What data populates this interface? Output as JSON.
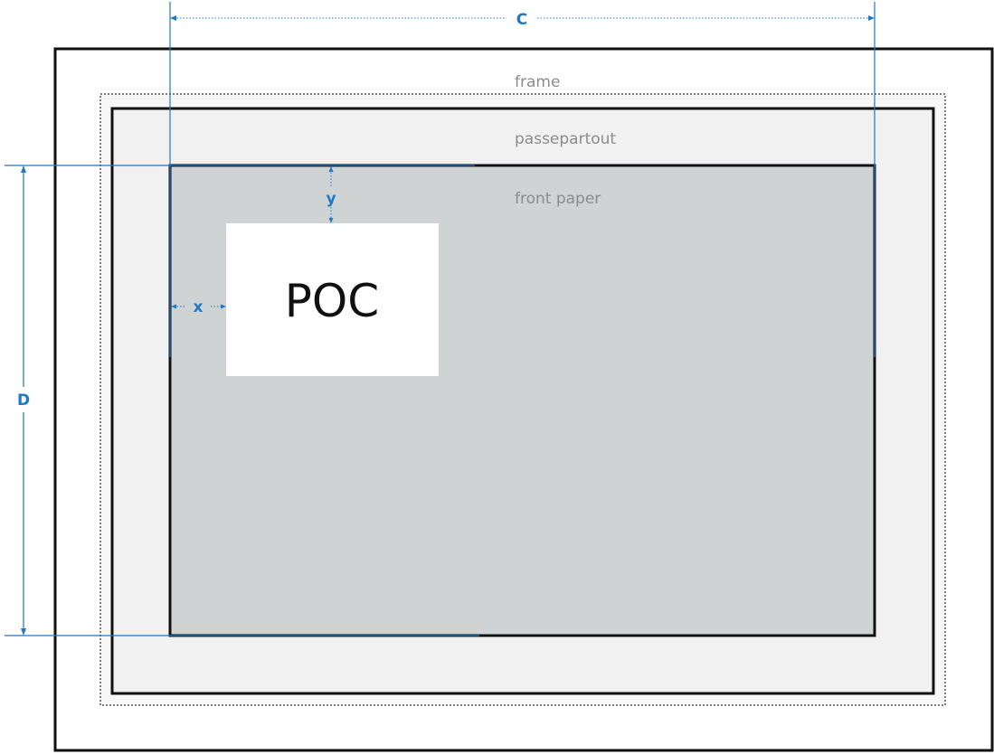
{
  "labels": {
    "frame": "frame",
    "passepartout": "passepartout",
    "front_paper": "front paper",
    "poc": "POC"
  },
  "dimensions": {
    "width": "C",
    "height": "D",
    "offset_x": "x",
    "offset_y": "y"
  },
  "colors": {
    "frame_fill": "#ffffff",
    "frame_border": "#111111",
    "passepartout_fill": "#f1f1f1",
    "front_paper_fill": "#d0d3d4",
    "poc_fill": "#ffffff",
    "dimension_color": "#1f78c8",
    "label_color": "#8c8c8c"
  }
}
